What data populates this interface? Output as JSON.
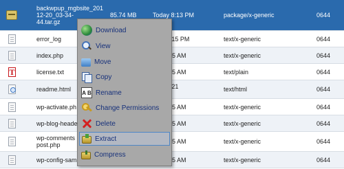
{
  "files": [
    {
      "name": "backwpup_mgbsite_201\n12-20_03-34-\n44.tar.gz",
      "size": "85.74 MB",
      "modified": "Today 8:13 PM",
      "type": "package/x-generic",
      "perms": "0644",
      "icon": "archive-icon",
      "selected": true
    },
    {
      "name": "error_log",
      "size": "",
      "modified": "2015 11:15 PM",
      "type": "text/x-generic",
      "perms": "0644",
      "icon": "file-icon"
    },
    {
      "name": "index.php",
      "size": "",
      "modified": "2015 4:55 AM",
      "type": "text/x-generic",
      "perms": "0644",
      "icon": "file-icon"
    },
    {
      "name": "license.txt",
      "size": "",
      "modified": "2015 4:55 AM",
      "type": "text/plain",
      "perms": "0644",
      "icon": "text-file-icon"
    },
    {
      "name": "readme.html",
      "size": "",
      "modified": "2015 11:21",
      "type": "text/html",
      "perms": "0644",
      "icon": "html-file-icon"
    },
    {
      "name": "wp-activate.ph",
      "size": "",
      "modified": "2015 4:55 AM",
      "type": "text/x-generic",
      "perms": "0644",
      "icon": "file-icon"
    },
    {
      "name": "wp-blog-heade",
      "size": "",
      "modified": "2015 4:55 AM",
      "type": "text/x-generic",
      "perms": "0644",
      "icon": "file-icon"
    },
    {
      "name": "wp-comments\npost.php",
      "size": "",
      "modified": "2015 4:55 AM",
      "type": "text/x-generic",
      "perms": "0644",
      "icon": "file-icon"
    },
    {
      "name": "wp-config-sam",
      "size": "",
      "modified": "2015 4:55 AM",
      "type": "text/x-generic",
      "perms": "0644",
      "icon": "file-icon"
    }
  ],
  "context_menu": {
    "items": [
      {
        "label": "Download",
        "icon": "download-globe-icon"
      },
      {
        "label": "View",
        "icon": "magnifier-icon"
      },
      {
        "label": "Move",
        "icon": "move-icon"
      },
      {
        "label": "Copy",
        "icon": "copy-icon"
      },
      {
        "label": "Rename",
        "icon": "rename-icon"
      },
      {
        "label": "Change Permissions",
        "icon": "key-icon"
      },
      {
        "label": "Delete",
        "icon": "delete-x-icon"
      },
      {
        "label": "Extract",
        "icon": "extract-icon",
        "highlighted": true
      },
      {
        "label": "Compress",
        "icon": "compress-icon"
      }
    ],
    "rename_icon_text": "A B"
  },
  "colors": {
    "selected_row": "#2a6aad",
    "menu_bg": "#a8a8a8",
    "menu_text": "#16307a",
    "highlight_border": "#4d86c6"
  }
}
